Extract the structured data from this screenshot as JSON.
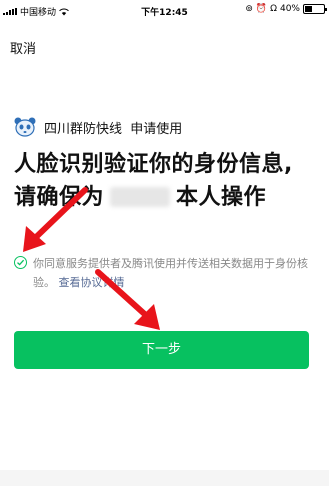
{
  "status_bar": {
    "carrier": "中国移动",
    "time": "下午12:45",
    "battery_percent": "40%",
    "battery_level": 0.4,
    "icons": [
      "signal-icon",
      "wifi-icon",
      "lock-rotation-icon",
      "alarm-icon",
      "headphones-icon",
      "battery-icon"
    ]
  },
  "nav": {
    "cancel_label": "取消"
  },
  "app": {
    "name": "四川群防快线",
    "action": "申请使用",
    "logo_icon": "panda-logo-icon"
  },
  "title": {
    "line1": "人脸识别验证你的身份信息,",
    "line2_prefix": "请确保为",
    "line2_suffix": "本人操作"
  },
  "agreement": {
    "text": "你同意服务提供者及腾讯使用并传送相关数据用于身份核验。",
    "link_label": "查看协议详情",
    "checked": true
  },
  "primary_button": {
    "label": "下一步"
  },
  "colors": {
    "accent": "#07c160",
    "link": "#576b95",
    "annotation": "#e8141b"
  }
}
